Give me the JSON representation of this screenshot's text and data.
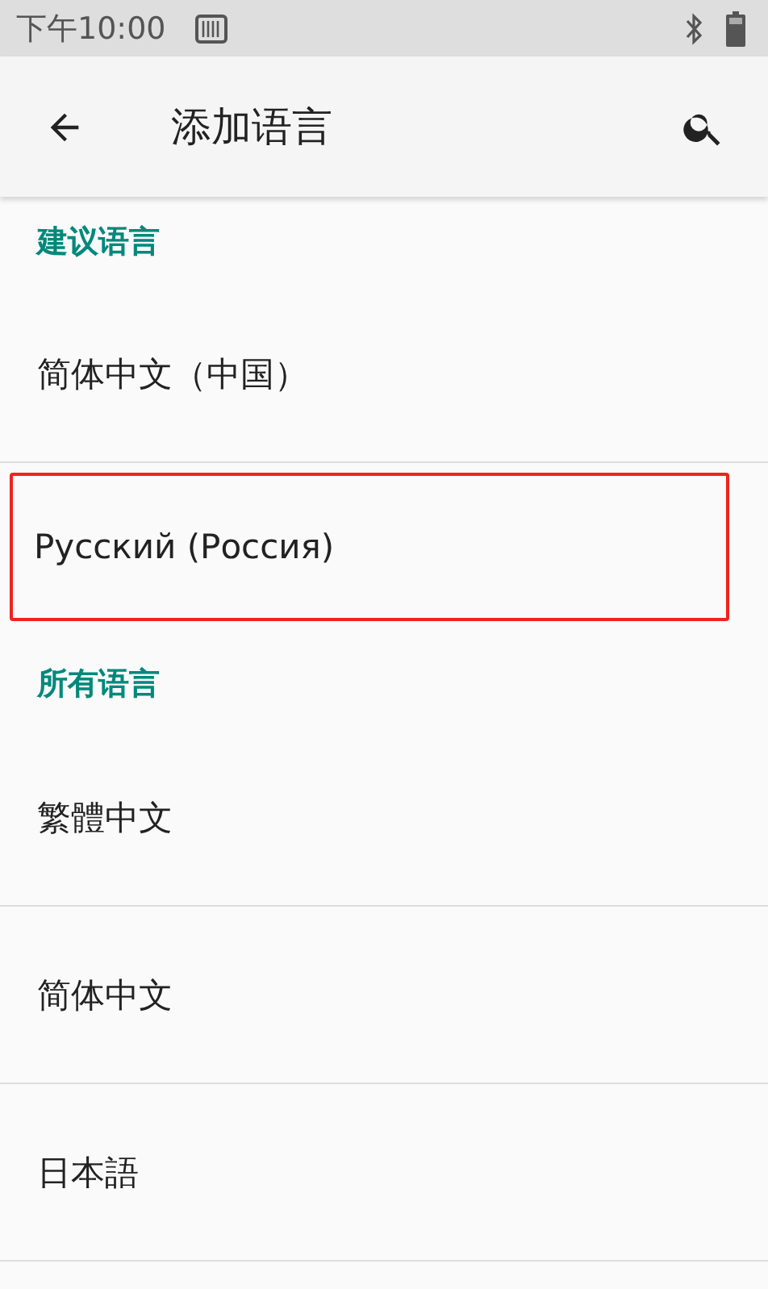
{
  "status_bar": {
    "time": "下午10:00"
  },
  "app_bar": {
    "title": "添加语言"
  },
  "sections": [
    {
      "header": "建议语言",
      "items": [
        {
          "label": "简体中文（中国）",
          "highlighted": false
        },
        {
          "label": "Русский (Россия)",
          "highlighted": true
        }
      ]
    },
    {
      "header": "所有语言",
      "items": [
        {
          "label": "繁體中文",
          "highlighted": false
        },
        {
          "label": "简体中文",
          "highlighted": false
        },
        {
          "label": "日本語",
          "highlighted": false
        }
      ]
    }
  ]
}
